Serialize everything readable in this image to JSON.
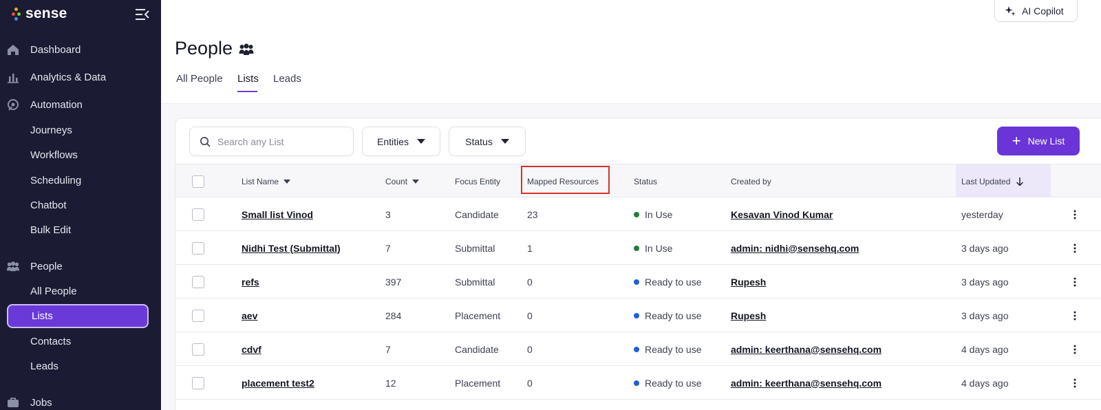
{
  "brand": {
    "name": "sense"
  },
  "sidebar": {
    "items": [
      {
        "label": "Dashboard"
      },
      {
        "label": "Analytics & Data"
      },
      {
        "label": "Automation"
      },
      {
        "label": "Journeys"
      },
      {
        "label": "Workflows"
      },
      {
        "label": "Scheduling"
      },
      {
        "label": "Chatbot"
      },
      {
        "label": "Bulk Edit"
      },
      {
        "label": "People"
      },
      {
        "label": "All People"
      },
      {
        "label": "Lists"
      },
      {
        "label": "Contacts"
      },
      {
        "label": "Leads"
      },
      {
        "label": "Jobs"
      }
    ]
  },
  "header": {
    "copilot_label": "AI Copilot",
    "title": "People"
  },
  "tabs": [
    {
      "label": "All People"
    },
    {
      "label": "Lists"
    },
    {
      "label": "Leads"
    }
  ],
  "toolbar": {
    "search_placeholder": "Search any List",
    "entities_label": "Entities",
    "status_label": "Status",
    "new_list_label": "New List"
  },
  "table": {
    "columns": [
      {
        "label": "List Name"
      },
      {
        "label": "Count"
      },
      {
        "label": "Focus Entity"
      },
      {
        "label": "Mapped Resources"
      },
      {
        "label": "Status"
      },
      {
        "label": "Created by"
      },
      {
        "label": "Last Updated"
      }
    ],
    "rows": [
      {
        "name": "Small list Vinod",
        "count": "3",
        "entity": "Candidate",
        "mapped": "23",
        "status": "In Use",
        "status_color": "#1e7d3a",
        "created_by": "Kesavan Vinod Kumar",
        "updated": "yesterday"
      },
      {
        "name": "Nidhi Test (Submittal)",
        "count": "7",
        "entity": "Submittal",
        "mapped": "1",
        "status": "In Use",
        "status_color": "#1e7d3a",
        "created_by": "admin: nidhi@sensehq.com",
        "updated": "3 days ago"
      },
      {
        "name": "refs",
        "count": "397",
        "entity": "Submittal",
        "mapped": "0",
        "status": "Ready to use",
        "status_color": "#1f5fd6",
        "created_by": "Rupesh",
        "updated": "3 days ago"
      },
      {
        "name": "aev",
        "count": "284",
        "entity": "Placement",
        "mapped": "0",
        "status": "Ready to use",
        "status_color": "#1f5fd6",
        "created_by": "Rupesh",
        "updated": "3 days ago"
      },
      {
        "name": "cdvf",
        "count": "7",
        "entity": "Candidate",
        "mapped": "0",
        "status": "Ready to use",
        "status_color": "#1f5fd6",
        "created_by": "admin: keerthana@sensehq.com",
        "updated": "4 days ago"
      },
      {
        "name": "placement test2",
        "count": "12",
        "entity": "Placement",
        "mapped": "0",
        "status": "Ready to use",
        "status_color": "#1f5fd6",
        "created_by": "admin: keerthana@sensehq.com",
        "updated": "4 days ago"
      }
    ]
  }
}
